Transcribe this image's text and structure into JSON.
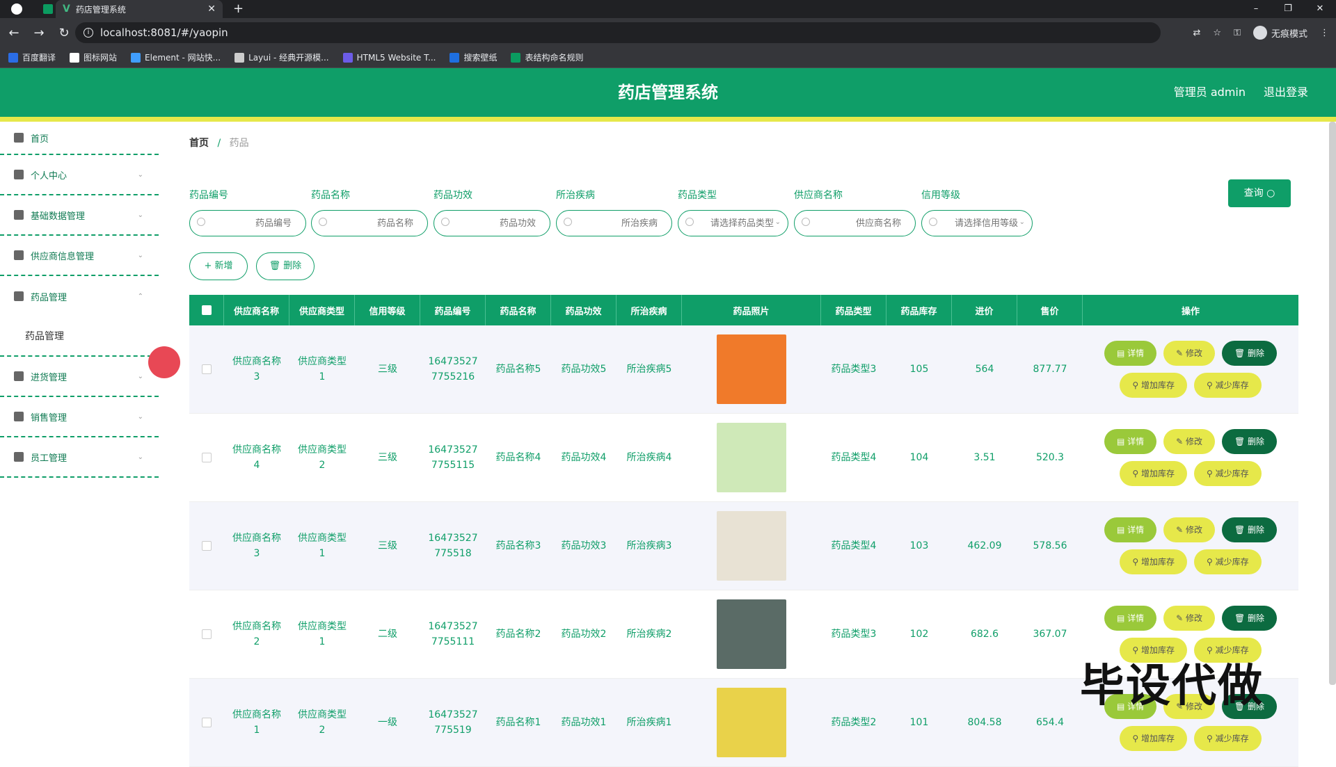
{
  "browser": {
    "tab_title": "药店管理系统",
    "url": "localhost:8081/#/yaopin",
    "incognito_label": "无痕模式",
    "bookmarks": [
      {
        "label": "百度翻译",
        "color": "#2b6de5"
      },
      {
        "label": "图标网站",
        "color": "#ffffff"
      },
      {
        "label": "Element - 网站快...",
        "color": "#409eff"
      },
      {
        "label": "Layui - 经典开源模...",
        "color": "#cccccc"
      },
      {
        "label": "HTML5 Website T...",
        "color": "#6c5ce7"
      },
      {
        "label": "搜索壁纸",
        "color": "#1e6fe0"
      },
      {
        "label": "表结构命名规则",
        "color": "#0b9b60"
      }
    ]
  },
  "header": {
    "title": "药店管理系统",
    "user": "管理员 admin",
    "logout": "退出登录"
  },
  "sidebar": {
    "items": [
      {
        "label": "首页",
        "icon": "home-icon"
      },
      {
        "label": "个人中心",
        "icon": "user-icon"
      },
      {
        "label": "基础数据管理",
        "icon": "location-icon"
      },
      {
        "label": "供应商信息管理",
        "icon": "monitor-icon"
      },
      {
        "label": "药品管理",
        "icon": "globe-icon"
      },
      {
        "label": "药品管理"
      },
      {
        "label": "进货管理",
        "icon": "chat-icon"
      },
      {
        "label": "销售管理",
        "icon": "doc-icon"
      },
      {
        "label": "员工管理",
        "icon": "truck-icon"
      }
    ]
  },
  "breadcrumb": {
    "home": "首页",
    "sep": "/",
    "current": "药品"
  },
  "filters": [
    {
      "label": "药品编号",
      "placeholder": "药品编号"
    },
    {
      "label": "药品名称",
      "placeholder": "药品名称"
    },
    {
      "label": "药品功效",
      "placeholder": "药品功效"
    },
    {
      "label": "所治疾病",
      "placeholder": "所治疾病"
    },
    {
      "label": "药品类型",
      "placeholder": "请选择药品类型"
    },
    {
      "label": "供应商名称",
      "placeholder": "供应商名称"
    },
    {
      "label": "信用等级",
      "placeholder": "请选择信用等级"
    }
  ],
  "buttons": {
    "query": "查询 ○",
    "add": "+ 新增",
    "delete": "🗑 删除"
  },
  "table": {
    "headers": [
      "",
      "供应商名称",
      "供应商类型",
      "信用等级",
      "药品编号",
      "药品名称",
      "药品功效",
      "所治疾病",
      "药品照片",
      "药品类型",
      "药品库存",
      "进价",
      "售价",
      "操作"
    ],
    "ops": {
      "detail": "▤ 详情",
      "edit": "✎ 修改",
      "delete": "🗑 删除",
      "inc": "⚲ 增加库存",
      "dec": "⚲ 减少库存"
    },
    "rows": [
      {
        "supplier": "供应商名称3",
        "stype": "供应商类型1",
        "credit": "三级",
        "code": "16473527 7755216",
        "name": "药品名称5",
        "effect": "药品功效5",
        "disease": "所治疾病5",
        "photo_color": "#f07a2a",
        "dtype": "药品类型3",
        "stock": "105",
        "cost": "564",
        "price": "877.77"
      },
      {
        "supplier": "供应商名称4",
        "stype": "供应商类型2",
        "credit": "三级",
        "code": "16473527 7755115",
        "name": "药品名称4",
        "effect": "药品功效4",
        "disease": "所治疾病4",
        "photo_color": "#cfe9b8",
        "dtype": "药品类型4",
        "stock": "104",
        "cost": "3.51",
        "price": "520.3"
      },
      {
        "supplier": "供应商名称3",
        "stype": "供应商类型1",
        "credit": "三级",
        "code": "16473527 775518",
        "name": "药品名称3",
        "effect": "药品功效3",
        "disease": "所治疾病3",
        "photo_color": "#e8e2d4",
        "dtype": "药品类型4",
        "stock": "103",
        "cost": "462.09",
        "price": "578.56"
      },
      {
        "supplier": "供应商名称2",
        "stype": "供应商类型1",
        "credit": "二级",
        "code": "16473527 7755111",
        "name": "药品名称2",
        "effect": "药品功效2",
        "disease": "所治疾病2",
        "photo_color": "#5a6b66",
        "dtype": "药品类型3",
        "stock": "102",
        "cost": "682.6",
        "price": "367.07"
      },
      {
        "supplier": "供应商名称1",
        "stype": "供应商类型2",
        "credit": "一级",
        "code": "16473527 775519",
        "name": "药品名称1",
        "effect": "药品功效1",
        "disease": "所治疾病1",
        "photo_color": "#e9d24a",
        "dtype": "药品类型2",
        "stock": "101",
        "cost": "804.58",
        "price": "654.4"
      }
    ]
  },
  "watermark": "毕设代做"
}
